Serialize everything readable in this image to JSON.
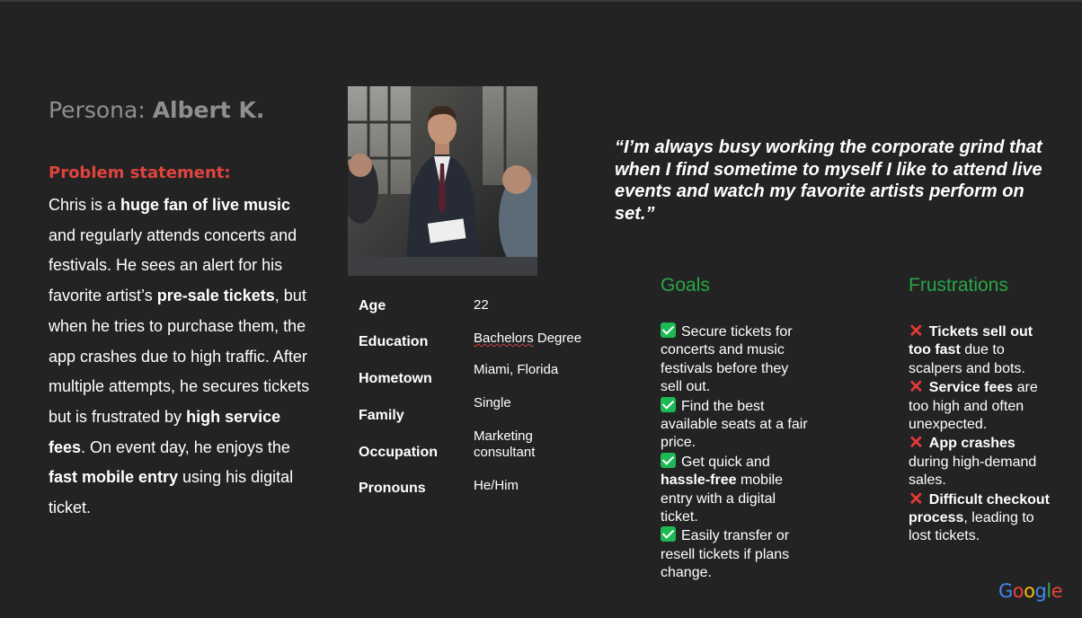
{
  "persona": {
    "prefix": "Persona: ",
    "name": "Albert K."
  },
  "problem": {
    "heading": "Problem statement:",
    "segments": [
      {
        "t": "Chris is a ",
        "b": false
      },
      {
        "t": "huge fan of live music",
        "b": true
      },
      {
        "t": " and regularly attends concerts and festivals. He sees an alert for his favorite artist’s ",
        "b": false
      },
      {
        "t": "pre-sale tickets",
        "b": true
      },
      {
        "t": ", but when he tries to purchase them, the app crashes due to high traffic. After multiple attempts, he secures tickets but is frustrated by ",
        "b": false
      },
      {
        "t": "high service fees",
        "b": true
      },
      {
        "t": ". On event day, he enjoys the ",
        "b": false
      },
      {
        "t": "fast mobile entry",
        "b": true
      },
      {
        "t": " using his digital ticket.",
        "b": false
      }
    ]
  },
  "info": {
    "age_label": "Age",
    "age_value": "22",
    "education_label": "Education",
    "education_value": "Bachelors",
    "education_value_rest": " Degree",
    "hometown_label": "Hometown",
    "hometown_value": "Miami, Florida",
    "family_label": "Family",
    "family_value": "Single",
    "occupation_label": "Occupation",
    "occupation_value": "Marketing consultant",
    "pronouns_label": "Pronouns",
    "pronouns_value": "He/Him"
  },
  "quote": "“I’m always busy working the corporate grind that when I find sometime to myself I like to attend live events and watch my favorite artists perform on set.”",
  "goals": {
    "heading": "Goals",
    "items": [
      {
        "segments": [
          {
            "t": "Secure tickets for concerts and music festivals before they sell out.",
            "b": false
          }
        ]
      },
      {
        "segments": [
          {
            "t": "Find the best available seats at a fair price.",
            "b": false
          }
        ]
      },
      {
        "segments": [
          {
            "t": "Get quick and ",
            "b": false
          },
          {
            "t": "hassle-free",
            "b": true
          },
          {
            "t": " mobile entry with a digital ticket.",
            "b": false
          }
        ]
      },
      {
        "segments": [
          {
            "t": "Easily transfer or resell tickets if plans change.",
            "b": false
          }
        ]
      }
    ]
  },
  "frustrations": {
    "heading": "Frustrations",
    "items": [
      {
        "segments": [
          {
            "t": "Tickets sell out too fast",
            "b": true
          },
          {
            "t": " due to scalpers and bots.",
            "b": false
          }
        ]
      },
      {
        "segments": [
          {
            "t": "Service fees",
            "b": true
          },
          {
            "t": " are too high and often unexpected.",
            "b": false
          }
        ]
      },
      {
        "segments": [
          {
            "t": "App crashes",
            "b": true
          },
          {
            "t": " during high-demand sales.",
            "b": false
          }
        ]
      },
      {
        "segments": [
          {
            "t": "Difficult checkout process",
            "b": true
          },
          {
            "t": ", leading to lost tickets.",
            "b": false
          }
        ]
      }
    ]
  },
  "logo": {
    "text": "Google",
    "colors": [
      "#4285F4",
      "#EA4335",
      "#FBBC05",
      "#4285F4",
      "#34A853",
      "#EA4335"
    ]
  },
  "colors": {
    "background": "#232323",
    "accent_red": "#e0443e",
    "accent_green": "#27a745"
  }
}
